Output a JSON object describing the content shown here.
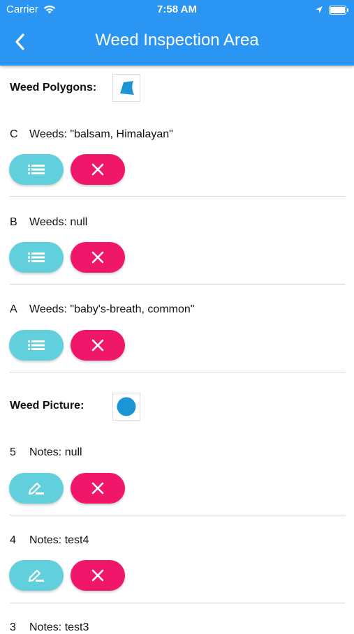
{
  "status_bar": {
    "carrier": "Carrier",
    "time": "7:58 AM"
  },
  "header": {
    "title": "Weed Inspection Area"
  },
  "polygons": {
    "label": "Weed Polygons:",
    "items": [
      {
        "id": "C",
        "field": "Weeds:",
        "value": "\"balsam, Himalayan\""
      },
      {
        "id": "B",
        "field": "Weeds:",
        "value": "null"
      },
      {
        "id": "A",
        "field": "Weeds:",
        "value": "\"baby's-breath, common\""
      }
    ]
  },
  "pictures": {
    "label": "Weed Picture:",
    "items": [
      {
        "id": "5",
        "field": "Notes:",
        "value": "null"
      },
      {
        "id": "4",
        "field": "Notes:",
        "value": "test4"
      },
      {
        "id": "3",
        "field": "Notes:",
        "value": "test3"
      }
    ]
  },
  "colors": {
    "header": "#2a95f3",
    "teal_button": "#62d0dc",
    "delete_button": "#f0176b",
    "icon_blue": "#1b95d6"
  },
  "icons": {
    "list": "list-icon",
    "edit": "edit-icon",
    "delete": "close-icon"
  }
}
